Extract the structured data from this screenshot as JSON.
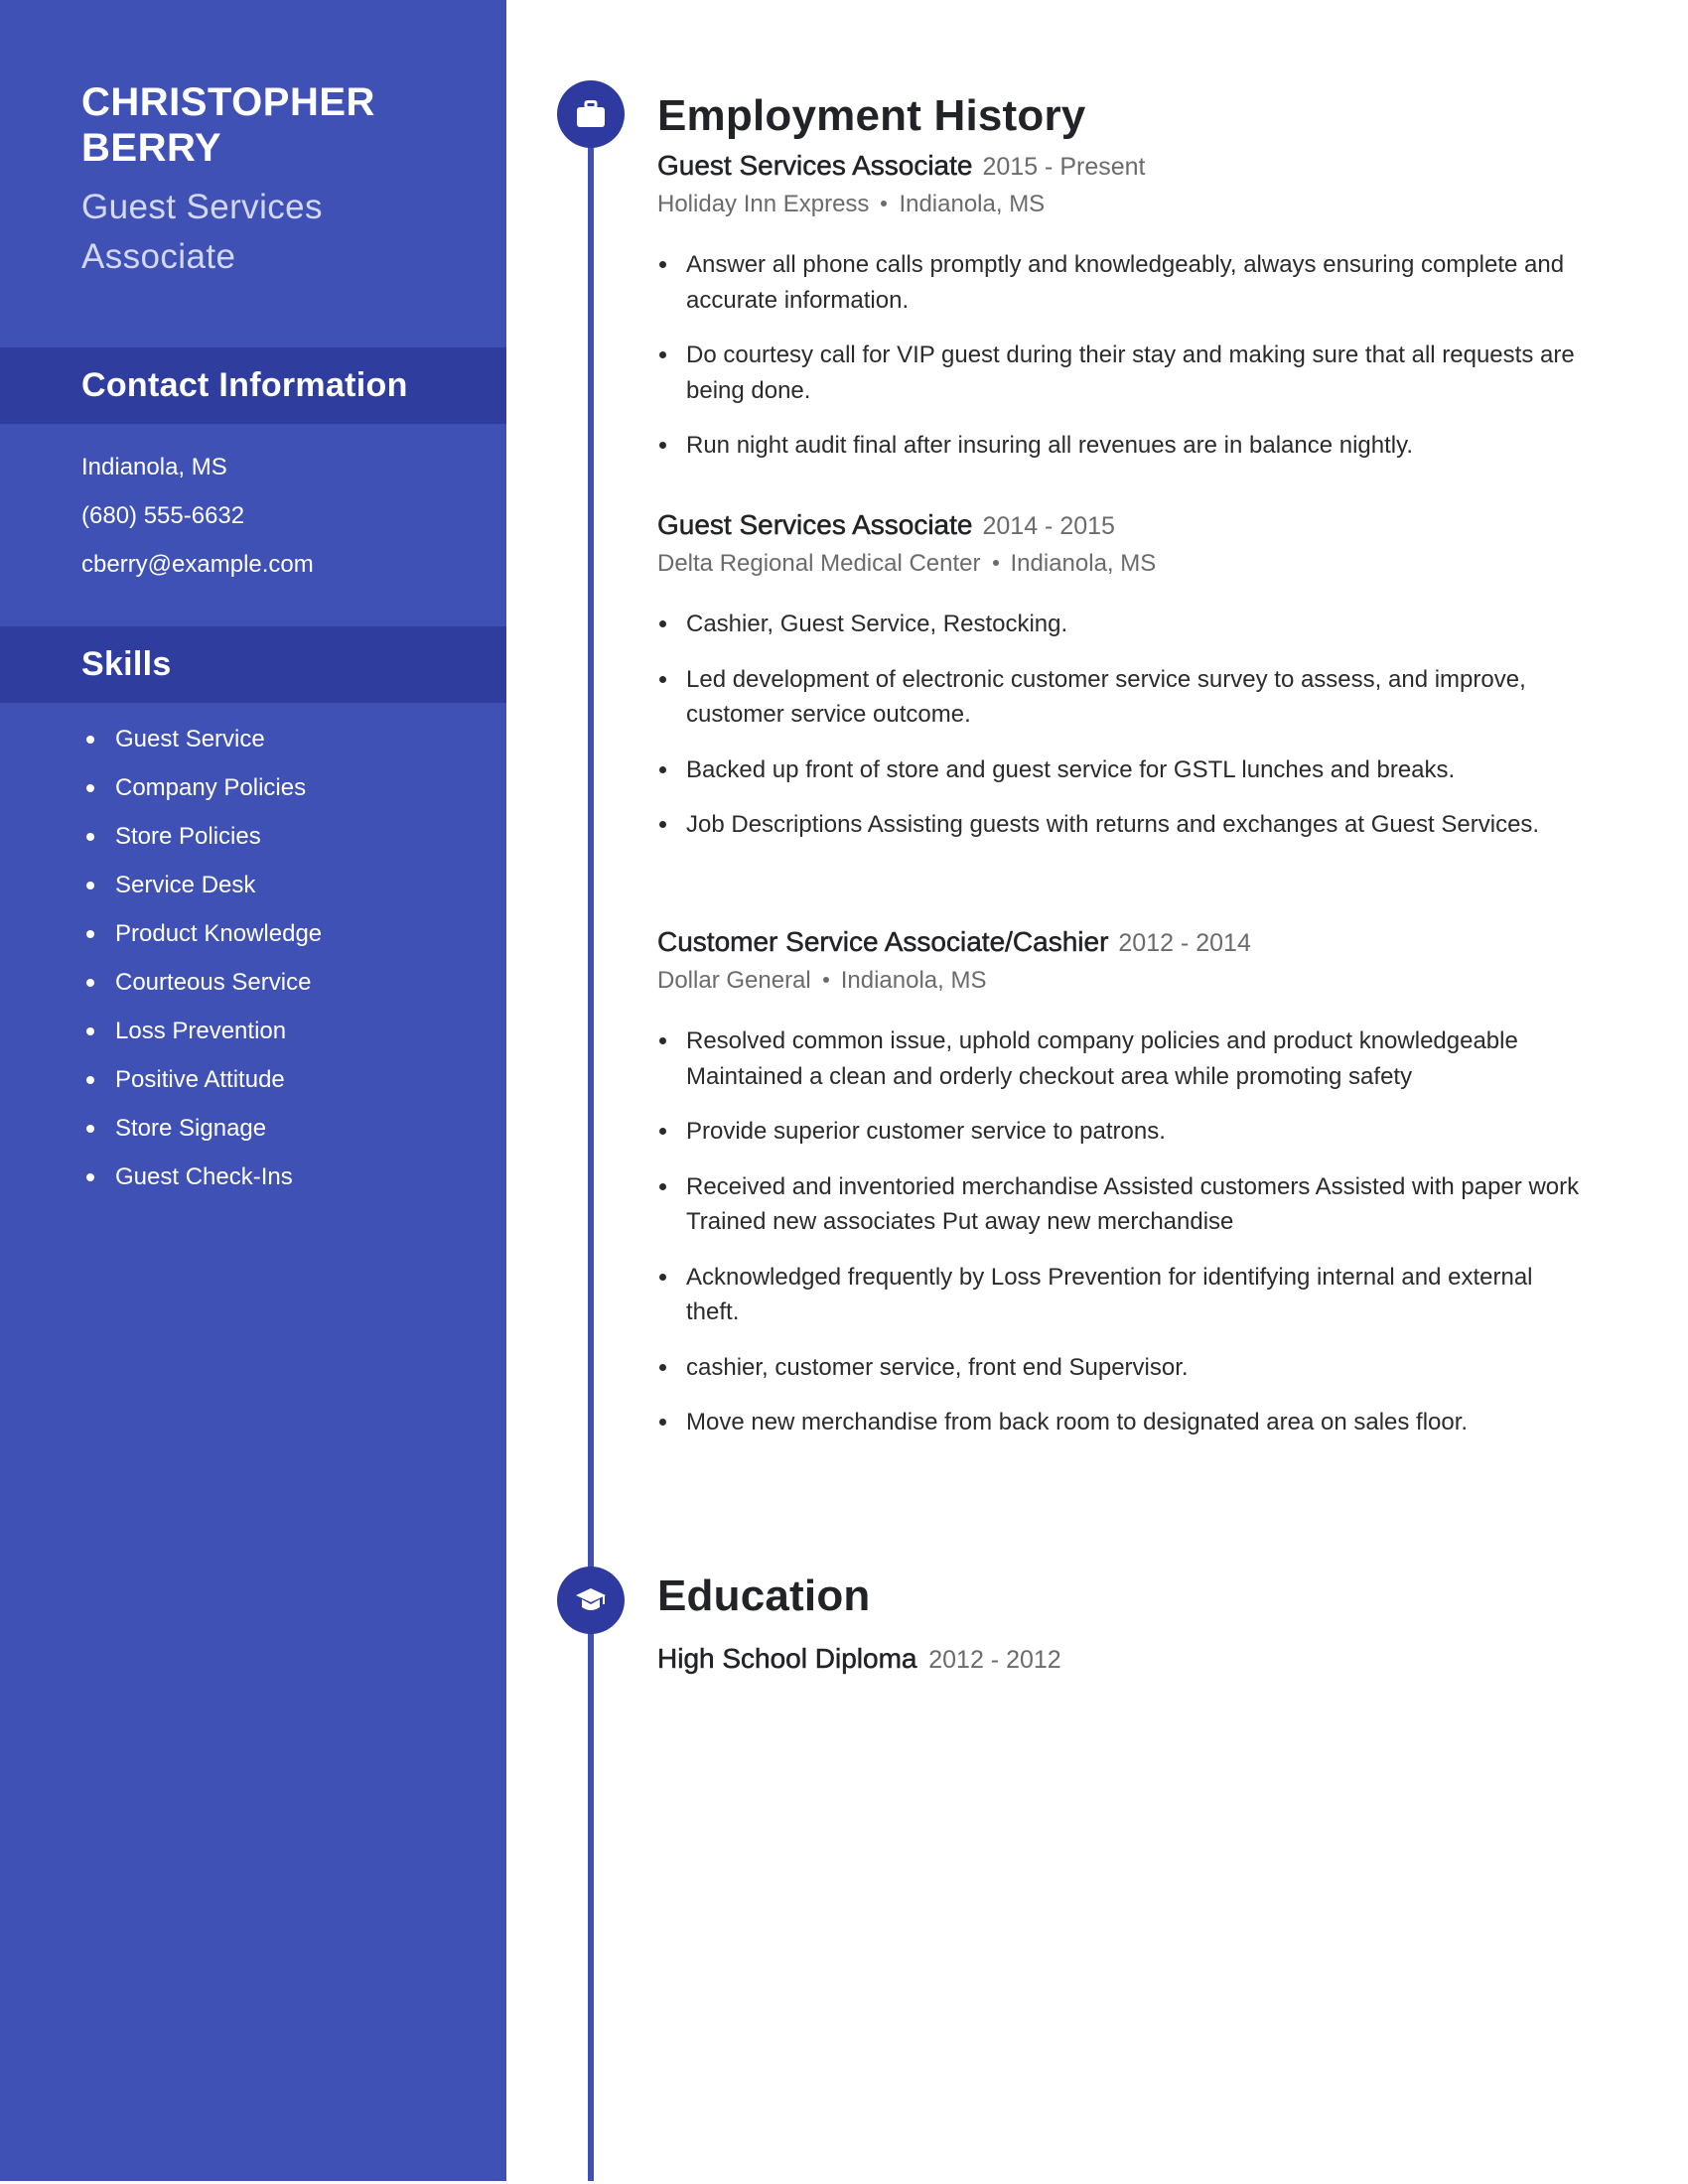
{
  "sidebar": {
    "name": "CHRISTOPHER BERRY",
    "role": "Guest Services Associate",
    "contact": {
      "heading": "Contact Information",
      "items": [
        "Indianola, MS",
        "(680) 555-6632",
        "cberry@example.com"
      ]
    },
    "skills": {
      "heading": "Skills",
      "items": [
        "Guest Service",
        "Company Policies",
        "Store Policies",
        "Service Desk",
        "Product Knowledge",
        "Courteous Service",
        "Loss Prevention",
        "Positive Attitude",
        "Store Signage",
        "Guest Check-Ins"
      ]
    }
  },
  "employment": {
    "heading": "Employment History",
    "icon": "briefcase-icon",
    "jobs": [
      {
        "title": "Guest Services Associate",
        "dates": "2015 - Present",
        "company": "Holiday Inn Express",
        "location": "Indianola, MS",
        "bullets": [
          "Answer all phone calls promptly and knowledgeably, always ensuring complete and accurate information.",
          "Do courtesy call for VIP guest during their stay and making sure that all requests are being done.",
          "Run night audit final after insuring all revenues are in balance nightly."
        ]
      },
      {
        "title": "Guest Services Associate",
        "dates": "2014 - 2015",
        "company": "Delta Regional Medical Center",
        "location": "Indianola, MS",
        "bullets": [
          "Cashier, Guest Service, Restocking.",
          "Led development of electronic customer service survey to assess, and improve, customer service outcome.",
          "Backed up front of store and guest service for GSTL lunches and breaks.",
          "Job Descriptions Assisting guests with returns and exchanges at Guest Services."
        ]
      },
      {
        "title": "Customer Service Associate/Cashier",
        "dates": "2012 - 2014",
        "company": "Dollar General",
        "location": "Indianola, MS",
        "bullets": [
          "Resolved common issue, uphold company policies and product knowledgeable Maintained a clean and orderly checkout area while promoting safety",
          "Provide superior customer service to patrons.",
          "Received and inventoried merchandise Assisted customers Assisted with paper work Trained new associates Put away new merchandise",
          "Acknowledged frequently by Loss Prevention for identifying internal and external theft.",
          "cashier, customer service, front end Supervisor.",
          "Move new merchandise from back room to designated area on sales floor."
        ]
      }
    ]
  },
  "education": {
    "heading": "Education",
    "icon": "graduation-cap-icon",
    "items": [
      {
        "degree": "High School Diploma",
        "dates": "2012 - 2012"
      }
    ]
  },
  "colors": {
    "sidebar": "#3f51b5",
    "sidebar_band": "#2f3d9f",
    "timeline_icon": "#2e3a9f",
    "timeline_line": "#3f51b5",
    "text_dark": "#222326",
    "text_muted": "#6b6b6b"
  }
}
